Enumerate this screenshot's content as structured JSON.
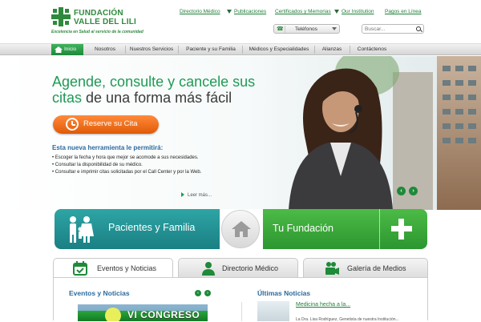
{
  "brand": {
    "name_line1": "FUNDACIÓN",
    "name_line2": "VALLE DEL LILI",
    "tagline": "Excelencia en Salud al servicio de la comunidad",
    "color_green": "#2e8a3c",
    "color_orange": "#f07020"
  },
  "top_links": [
    "Directorio Médico",
    "Publicaciones",
    "Certificados y Memorias",
    "Our Institution",
    "Pagos en Línea"
  ],
  "phone_button": {
    "label": "Teléfonos",
    "icon": "phone-icon"
  },
  "search": {
    "placeholder": "Buscar...",
    "value": "",
    "icon": "search-icon"
  },
  "nav": {
    "items": [
      "Inicio",
      "Nosotros",
      "Nuestros Servicios",
      "Paciente y su Familia",
      "Médicos y Especialidades",
      "Alianzas",
      "Contáctenos"
    ],
    "active_index": 0
  },
  "hero": {
    "title_green1": "Agende, consulte y cancele sus",
    "title_green2": "citas",
    "title_dark": "de una forma más fácil",
    "cta_label": "Reserve su Cita",
    "cta_icon": "clock-icon",
    "sub_title": "Esta nueva herramienta le permitirá:",
    "bullets": [
      "• Escoger la fecha y hora que mejor se acomode a sus necesidades.",
      "• Consultar la disponibilidad de su médico.",
      "• Consultar e imprimir citas solicitadas por el Call Center y por la Web."
    ],
    "read_more": "Leer más...",
    "prev": "‹",
    "next": "›"
  },
  "banner": {
    "left_label": "Pacientes y Familia",
    "right_label": "Tu Fundación",
    "left_icon": "family-icon",
    "center_icon": "home-icon",
    "right_icon": "plus-icon"
  },
  "tabs": [
    {
      "label": "Eventos y Noticias",
      "icon": "calendar-icon"
    },
    {
      "label": "Directorio Médico",
      "icon": "doctor-icon"
    },
    {
      "label": "Galería de Medios",
      "icon": "video-camera-icon"
    }
  ],
  "events": {
    "title": "Eventos y Noticias",
    "image_text": "VI CONGRESO",
    "prev": "‹",
    "next": "›"
  },
  "news": {
    "title": "Últimas Noticias",
    "link": "Medicina hecha a la...",
    "snippet": "La Dra. Lisa Rodríguez, Genetista de nuestra Institución..."
  }
}
